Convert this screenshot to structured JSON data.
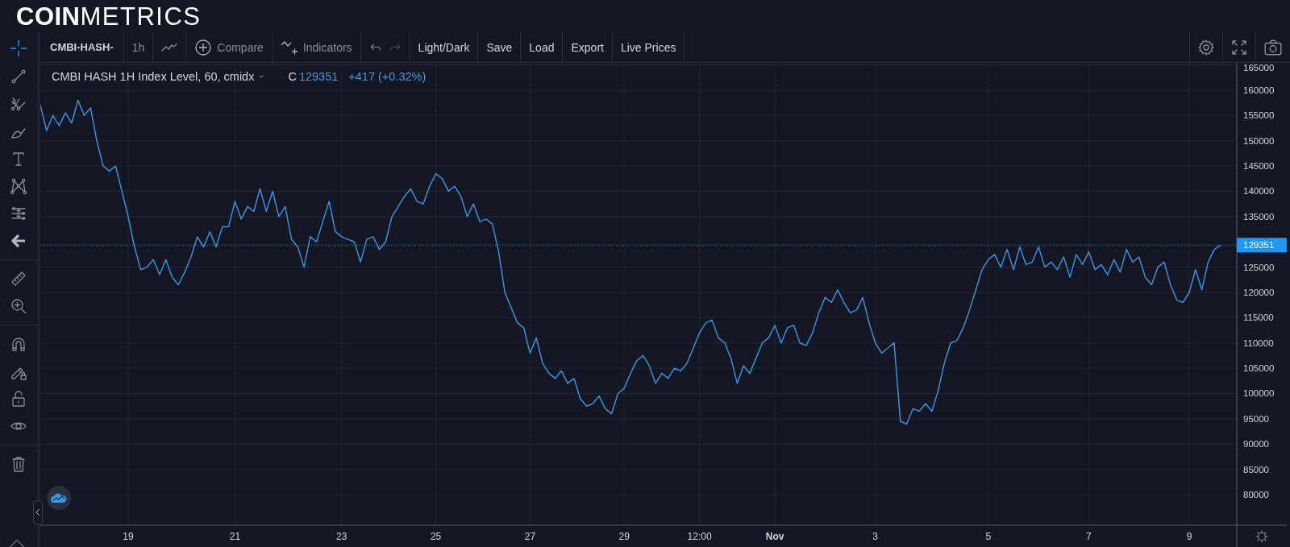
{
  "logo": {
    "bold": "COIN",
    "light": "METRICS"
  },
  "toolbar": {
    "symbol": "CMBI-HASH-",
    "interval": "1h",
    "tools": [
      "Compare",
      "Indicators"
    ],
    "actions": [
      "Light/Dark",
      "Save",
      "Load",
      "Export",
      "Live Prices"
    ]
  },
  "legend": {
    "title": "CMBI HASH 1H Index Level, 60, cmidx",
    "close_label": "C",
    "close": "129351",
    "change": "+417 (+0.32%)"
  },
  "chart": {
    "last_price_label": "129351",
    "chart_data": {
      "type": "line",
      "categories": [
        null,
        null,
        null,
        null,
        null,
        null,
        null,
        null,
        null,
        null,
        null,
        null,
        null,
        null,
        "19",
        null,
        null,
        null,
        null,
        null,
        null,
        null,
        null,
        null,
        null,
        null,
        null,
        null,
        null,
        null,
        null,
        "21",
        null,
        null,
        null,
        null,
        null,
        null,
        null,
        null,
        null,
        null,
        null,
        null,
        null,
        null,
        null,
        null,
        "23",
        null,
        null,
        null,
        null,
        null,
        null,
        null,
        null,
        null,
        null,
        null,
        null,
        null,
        null,
        "25",
        null,
        null,
        null,
        null,
        null,
        null,
        null,
        null,
        null,
        null,
        null,
        null,
        null,
        null,
        "27",
        null,
        null,
        null,
        null,
        null,
        null,
        null,
        null,
        null,
        null,
        null,
        null,
        null,
        null,
        "29",
        null,
        null,
        null,
        null,
        null,
        null,
        null,
        null,
        null,
        null,
        null,
        "12:00",
        null,
        null,
        null,
        null,
        null,
        null,
        null,
        null,
        null,
        null,
        null,
        "Nov",
        null,
        null,
        null,
        null,
        null,
        null,
        null,
        null,
        null,
        null,
        null,
        null,
        null,
        null,
        null,
        "3",
        null,
        null,
        null,
        null,
        null,
        null,
        null,
        null,
        null,
        null,
        null,
        null,
        null,
        null,
        null,
        null,
        null,
        "5",
        null,
        null,
        null,
        null,
        null,
        null,
        null,
        null,
        null,
        null,
        null,
        null,
        null,
        null,
        null,
        "7",
        null,
        null,
        null,
        null,
        null,
        null,
        null,
        null,
        null,
        null,
        null,
        null,
        null,
        null,
        null,
        "9",
        null,
        null,
        null,
        null,
        null
      ],
      "series": [
        {
          "color": "#3a8fde",
          "values": [
            157000,
            152000,
            155000,
            153000,
            155500,
            153500,
            158000,
            155000,
            156500,
            150000,
            145000,
            144000,
            145000,
            140000,
            135000,
            129000,
            124500,
            125000,
            126500,
            123500,
            126500,
            123000,
            121500,
            124000,
            127000,
            131000,
            129000,
            132000,
            129000,
            133000,
            133000,
            138000,
            134500,
            137000,
            136000,
            140500,
            136000,
            140000,
            135000,
            137000,
            130500,
            129000,
            125000,
            131000,
            130000,
            134000,
            138000,
            132000,
            131000,
            130500,
            130000,
            126000,
            130500,
            131000,
            128500,
            130000,
            135000,
            137000,
            139000,
            140500,
            138000,
            137500,
            141000,
            143500,
            142500,
            140000,
            141000,
            139000,
            135000,
            137500,
            134000,
            134500,
            133500,
            128000,
            120000,
            117000,
            114000,
            113000,
            108000,
            111000,
            106000,
            104000,
            103000,
            104500,
            102000,
            103000,
            99000,
            97500,
            98000,
            99500,
            97000,
            96000,
            100000,
            101000,
            104000,
            106500,
            107500,
            105500,
            102000,
            104000,
            103000,
            105000,
            104500,
            106000,
            109000,
            112000,
            114000,
            114500,
            111000,
            110000,
            107000,
            102000,
            105500,
            104000,
            107000,
            110000,
            111000,
            113500,
            110000,
            113000,
            113500,
            110000,
            109500,
            112000,
            116000,
            119000,
            118000,
            120500,
            118000,
            116000,
            116500,
            119000,
            114000,
            110000,
            108000,
            109000,
            110000,
            94500,
            94000,
            97000,
            96500,
            98000,
            96500,
            100500,
            106000,
            110000,
            110500,
            113000,
            116500,
            120500,
            124500,
            126500,
            127500,
            125000,
            128500,
            124500,
            129000,
            125500,
            126000,
            129000,
            125000,
            126000,
            124500,
            127000,
            123000,
            127500,
            125500,
            128000,
            124500,
            125500,
            123500,
            126500,
            124000,
            128500,
            126000,
            127000,
            123000,
            121500,
            125000,
            126000,
            121500,
            118500,
            118000,
            120000,
            124500,
            120500,
            126000,
            128500,
            129351
          ]
        }
      ],
      "ylim": [
        73950,
        165400
      ],
      "grid": true,
      "ref_lines": [
        {
          "axis": "y",
          "value": 129351
        }
      ],
      "yticks": [
        80000,
        85000,
        90000,
        95000,
        100000,
        105000,
        110000,
        115000,
        120000,
        125000,
        135000,
        140000,
        145000,
        150000,
        155000,
        160000,
        165000
      ]
    }
  }
}
